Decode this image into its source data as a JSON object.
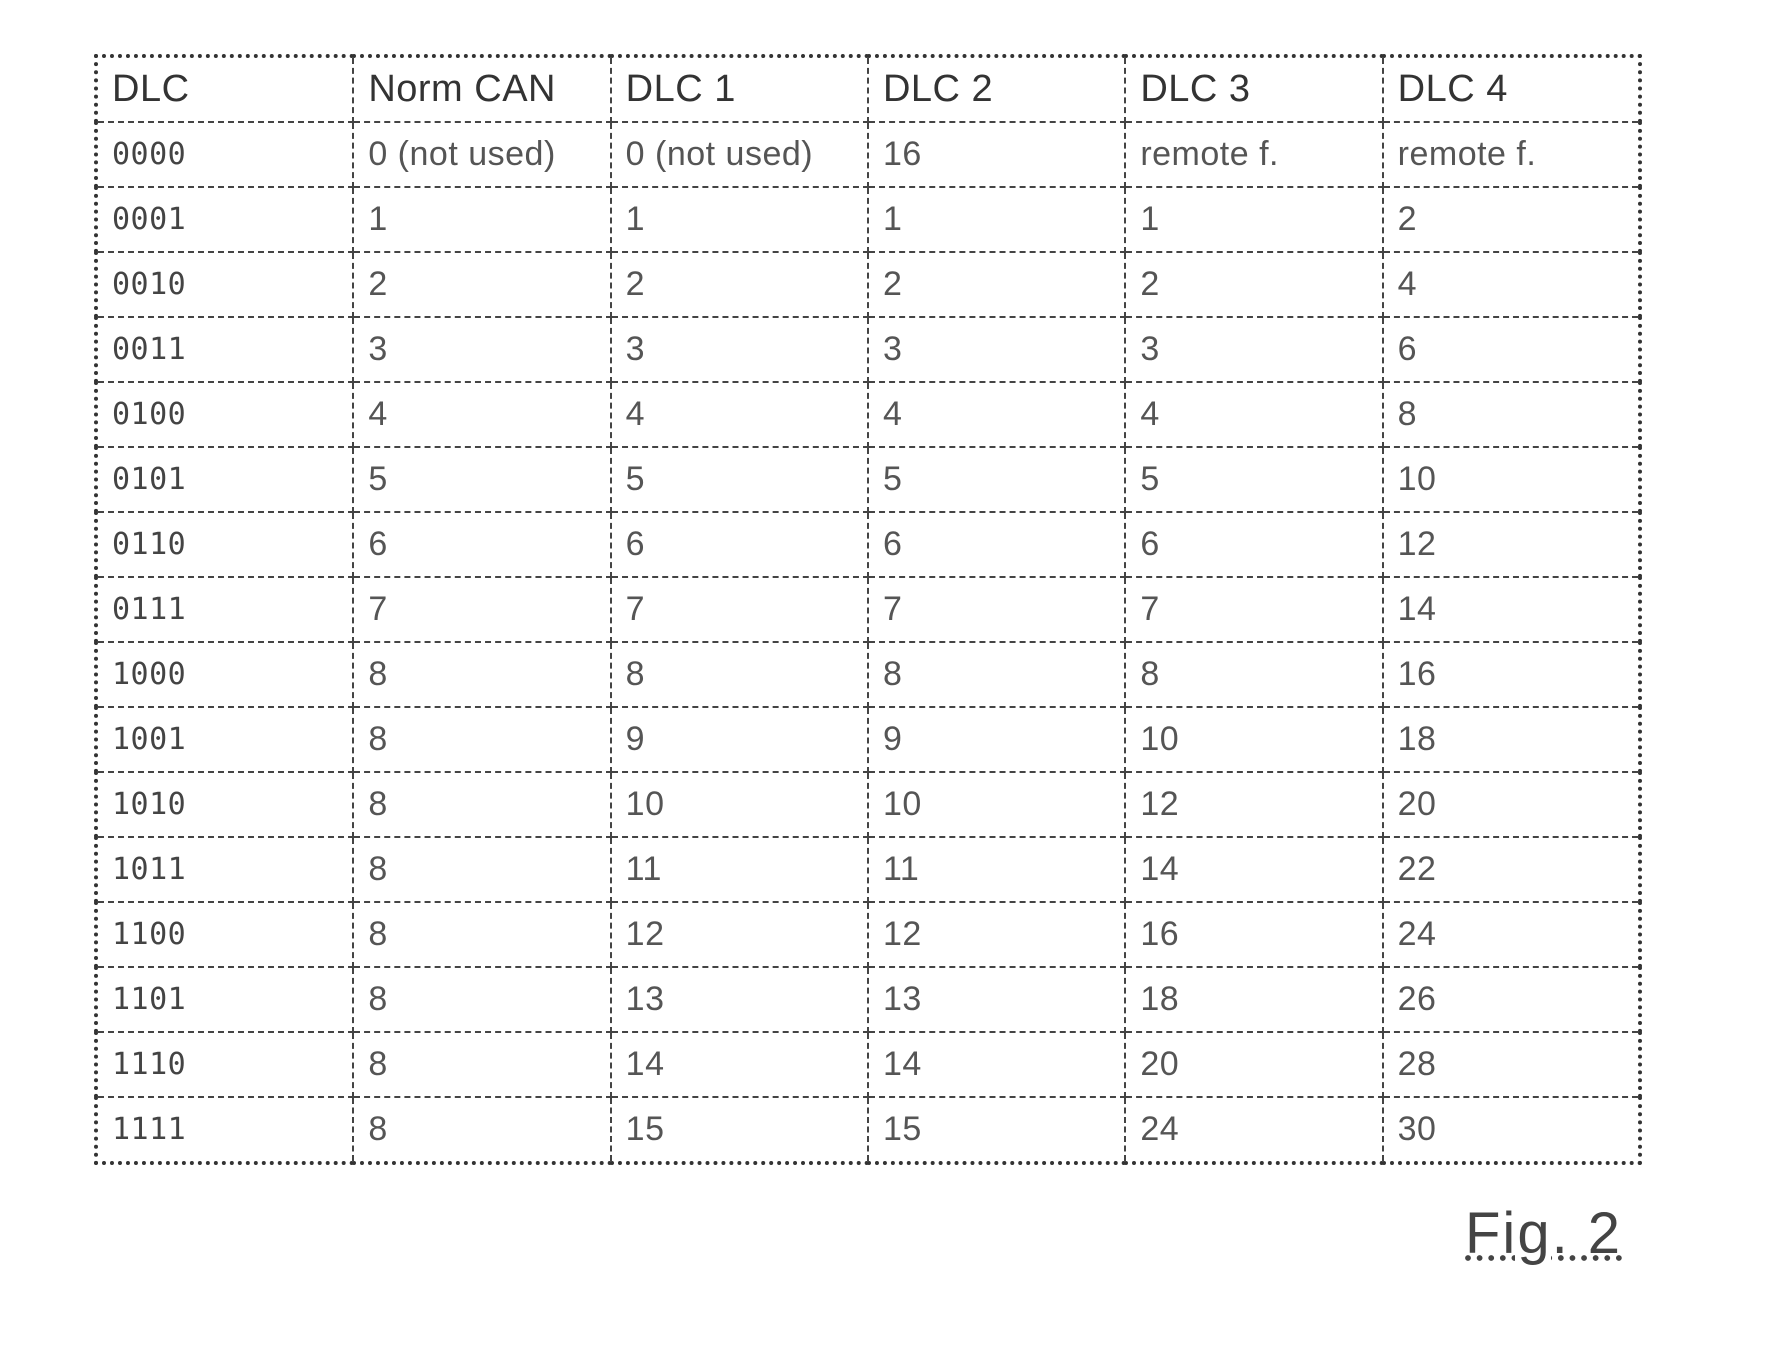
{
  "table": {
    "headers": [
      "DLC",
      "Norm CAN",
      "DLC 1",
      "DLC 2",
      "DLC 3",
      "DLC 4"
    ],
    "rows": [
      [
        "0000",
        "0 (not used)",
        "0 (not used)",
        "16",
        "remote f.",
        "remote f."
      ],
      [
        "0001",
        "1",
        "1",
        "1",
        "1",
        "2"
      ],
      [
        "0010",
        "2",
        "2",
        "2",
        "2",
        "4"
      ],
      [
        "0011",
        "3",
        "3",
        "3",
        "3",
        "6"
      ],
      [
        "0100",
        "4",
        "4",
        "4",
        "4",
        "8"
      ],
      [
        "0101",
        "5",
        "5",
        "5",
        "5",
        "10"
      ],
      [
        "0110",
        "6",
        "6",
        "6",
        "6",
        "12"
      ],
      [
        "0111",
        "7",
        "7",
        "7",
        "7",
        "14"
      ],
      [
        "1000",
        "8",
        "8",
        "8",
        "8",
        "16"
      ],
      [
        "1001",
        "8",
        "9",
        "9",
        "10",
        "18"
      ],
      [
        "1010",
        "8",
        "10",
        "10",
        "12",
        "20"
      ],
      [
        "1011",
        "8",
        "11",
        "11",
        "14",
        "22"
      ],
      [
        "1100",
        "8",
        "12",
        "12",
        "16",
        "24"
      ],
      [
        "1101",
        "8",
        "13",
        "13",
        "18",
        "26"
      ],
      [
        "1110",
        "8",
        "14",
        "14",
        "20",
        "28"
      ],
      [
        "1111",
        "8",
        "15",
        "15",
        "24",
        "30"
      ]
    ]
  },
  "figure_label": "Fig. 2"
}
